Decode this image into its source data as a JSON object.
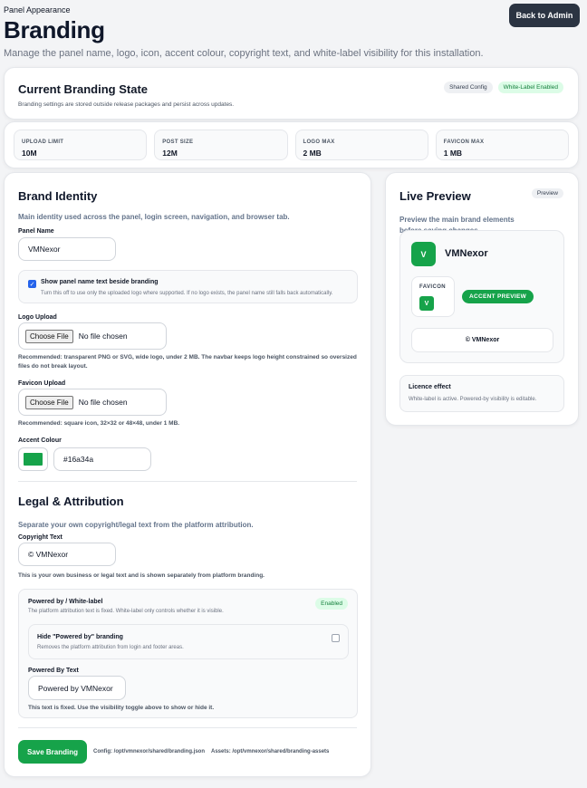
{
  "header": {
    "breadcrumb": "Panel Appearance",
    "title": "Branding",
    "subtitle": "Manage the panel name, logo, icon, accent colour, copyright text, and white-label visibility for this installation.",
    "back_button": "Back to Admin"
  },
  "state": {
    "title": "Current Branding State",
    "description": "Branding settings are stored outside release packages and persist across updates.",
    "badges": [
      "Shared Config",
      "White-Label Enabled"
    ]
  },
  "limits": [
    {
      "label": "UPLOAD LIMIT",
      "value": "10M"
    },
    {
      "label": "POST SIZE",
      "value": "12M"
    },
    {
      "label": "LOGO MAX",
      "value": "2 MB"
    },
    {
      "label": "FAVICON MAX",
      "value": "1 MB"
    }
  ],
  "identity": {
    "title": "Brand Identity",
    "subtitle": "Main identity used across the panel, login screen, navigation, and browser tab.",
    "panel_name_label": "Panel Name",
    "panel_name_value": "VMNexor",
    "show_name_label": "Show panel name text beside branding",
    "show_name_hint": "Turn this off to use only the uploaded logo where supported. If no logo exists, the panel name still falls back automatically.",
    "logo_label": "Logo Upload",
    "choose_file": "Choose File",
    "no_file": "No file chosen",
    "logo_hint": "Recommended: transparent PNG or SVG, wide logo, under 2 MB. The navbar keeps logo height constrained so oversized files do not break layout.",
    "favicon_label": "Favicon Upload",
    "favicon_hint": "Recommended: square icon, 32×32 or 48×48, under 1 MB.",
    "accent_label": "Accent Colour",
    "accent_value": "#16a34a"
  },
  "legal": {
    "title": "Legal & Attribution",
    "subtitle": "Separate your own copyright/legal text from the platform attribution.",
    "copyright_label": "Copyright Text",
    "copyright_value": "© VMNexor",
    "copyright_hint": "This is your own business or legal text and is shown separately from platform branding.",
    "powered_title": "Powered by / White-label",
    "powered_badge": "Enabled",
    "powered_desc": "The platform attribution text is fixed. White-label only controls whether it is visible.",
    "hide_label": "Hide \"Powered by\" branding",
    "hide_hint": "Removes the platform attribution from login and footer areas.",
    "powered_text_label": "Powered By Text",
    "powered_text_value": "Powered by VMNexor",
    "powered_text_hint": "This text is fixed. Use the visibility toggle above to show or hide it."
  },
  "footer": {
    "save_button": "Save Branding",
    "config_path": "Config: /opt/vmnexor/shared/branding.json",
    "assets_path": "Assets: /opt/vmnexor/shared/branding-assets"
  },
  "preview": {
    "title": "Live Preview",
    "badge": "Preview",
    "subtitle": "Preview the main brand elements before saving changes.",
    "brand_letter": "V",
    "brand_name": "VMNexor",
    "favicon_label": "FAVICON",
    "favicon_letter": "V",
    "accent_button": "ACCENT PREVIEW",
    "copyright": "© VMNexor",
    "licence_title": "Licence effect",
    "licence_desc": "White-label is active. Powered-by visibility is editable."
  },
  "colors": {
    "accent": "#16a34a",
    "dark_button": "#2b3442",
    "checkbox_blue": "#2563eb"
  }
}
